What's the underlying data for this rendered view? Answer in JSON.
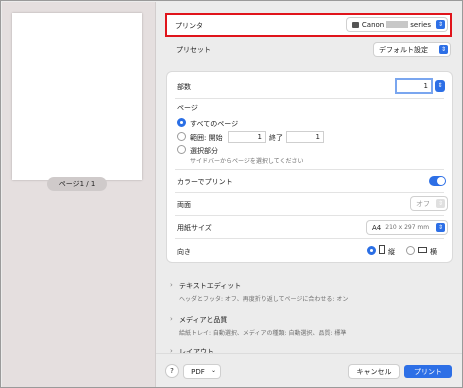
{
  "preview": {
    "page_indicator": "ページ1 / 1"
  },
  "printer": {
    "label": "プリンタ",
    "value_prefix": "Canon",
    "value_suffix": "series",
    "icon": "printer-icon"
  },
  "preset": {
    "label": "プリセット",
    "value": "デフォルト設定"
  },
  "copies": {
    "label": "部数",
    "value": "1"
  },
  "pages": {
    "label": "ページ",
    "all_label": "すべてのページ",
    "range_label": "範囲: 開始",
    "range_from": "1",
    "range_to_label": "終了",
    "range_to": "1",
    "selection_label": "選択部分",
    "selection_hint": "サイドバーからページを選択してください"
  },
  "color": {
    "label": "カラーでプリント"
  },
  "duplex": {
    "label": "両面",
    "value": "オフ"
  },
  "paper": {
    "label": "用紙サイズ",
    "value": "A4",
    "detail": "210 x 297 mm"
  },
  "orientation": {
    "label": "向き",
    "portrait": "縦",
    "landscape": "横"
  },
  "sections": [
    {
      "title": "テキストエディット",
      "desc": "ヘッダとフッタ: オフ、再度折り返してページに合わせる: オン"
    },
    {
      "title": "メディアと品質",
      "desc": "給紙トレイ: 自動選択、メディアの種類: 自動選択、品質: 標準"
    },
    {
      "title": "レイアウト",
      "desc": ""
    }
  ],
  "footer": {
    "help": "?",
    "pdf": "PDF",
    "cancel": "キャンセル",
    "print": "プリント"
  },
  "colors": {
    "accent": "#2d6fe6",
    "highlight": "#e0141b"
  }
}
